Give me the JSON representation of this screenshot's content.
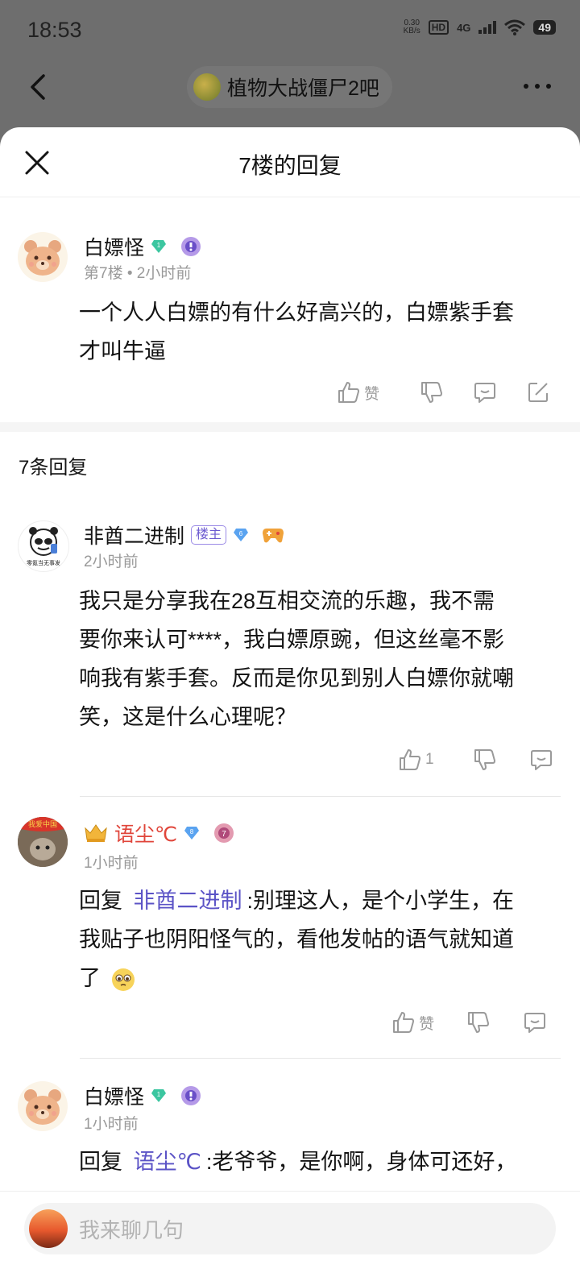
{
  "status_bar": {
    "time": "18:53",
    "speed_top": "0.30",
    "speed_bottom": "KB/s",
    "hd": "HD",
    "network": "4G",
    "battery": "49"
  },
  "nav": {
    "forum_name": "植物大战僵尸2吧"
  },
  "sheet": {
    "title": "7楼的回复"
  },
  "main_post": {
    "author": "白嫖怪",
    "level": "1",
    "floor": "第7楼",
    "time": "2小时前",
    "text_line1": "一个人人白嫖的有什么好高兴的，白嫖紫手套",
    "text_line2": "才叫牛逼",
    "like_label": "赞"
  },
  "replies_header": "7条回复",
  "replies": [
    {
      "author": "非酋二进制",
      "tag": "楼主",
      "level": "6",
      "avatar_text": "零氪当无事发",
      "time": "2小时前",
      "text_lines": [
        "我只是分享我在28互相交流的乐趣，我不需",
        "要你来认可****，我白嫖原豌，但这丝毫不影",
        "响我有紫手套。反而是你见到别人白嫖你就嘲",
        "笑，这是什么心理呢？"
      ],
      "like_count": "1"
    },
    {
      "author": "语尘℃",
      "level": "8",
      "avatar_text": "我爱中国",
      "time": "1小时前",
      "reply_prefix": "回复",
      "reply_to": "非酋二进制",
      "text_line1": ":别理这人，是个小学生，在",
      "text_line2": "我贴子也阴阳怪气的，看他发帖的语气就知道",
      "text_line3": "了",
      "like_label": "赞"
    },
    {
      "author": "白嫖怪",
      "level": "1",
      "time": "1小时前",
      "reply_prefix": "回复",
      "reply_to": "语尘℃",
      "text_line1": ":老爷爷，是你啊，身体可还好，"
    }
  ],
  "input": {
    "placeholder": "我来聊几句"
  },
  "colors": {
    "accent_purple": "#5b53c6",
    "vip_red": "#e0453a",
    "gem_green": "#3cc6a0",
    "gem_blue": "#5aa3f0"
  }
}
